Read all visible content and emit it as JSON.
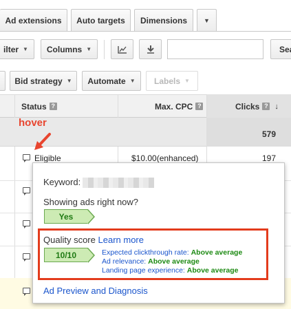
{
  "tabs": [
    {
      "label": "Ad extensions"
    },
    {
      "label": "Auto targets"
    },
    {
      "label": "Dimensions"
    }
  ],
  "toolbar1": {
    "filter_label": "ilter",
    "columns_label": "Columns",
    "search_value": "",
    "search_button_label": "Sea"
  },
  "toolbar2": {
    "bid_strategy_label": "Bid strategy",
    "automate_label": "Automate",
    "labels_label": "Labels"
  },
  "table": {
    "headers": {
      "status": "Status",
      "max_cpc": "Max. CPC",
      "clicks": "Clicks"
    },
    "total_clicks": "579",
    "rows": [
      {
        "status": "Eligible",
        "max_cpc": "$10.00(enhanced)",
        "clicks": "197"
      }
    ]
  },
  "annotation": {
    "hover": "hover",
    "color": "#e8452f"
  },
  "popup": {
    "keyword_label": "Keyword:",
    "showing_question": "Showing ads right now?",
    "showing_answer": "Yes",
    "quality_score_label": "Quality score",
    "learn_more": "Learn more",
    "score": "10/10",
    "ctr_label": "Expected clickthrough rate:",
    "ctr_value": "Above average",
    "relevance_label": "Ad relevance:",
    "relevance_value": "Above average",
    "landing_label": "Landing page experience:",
    "landing_value": "Above average",
    "diagnosis_link": "Ad Preview and Diagnosis"
  },
  "colors": {
    "link": "#1a55cc",
    "positive": "#1d8a13",
    "highlight_box": "#e33b1c"
  }
}
